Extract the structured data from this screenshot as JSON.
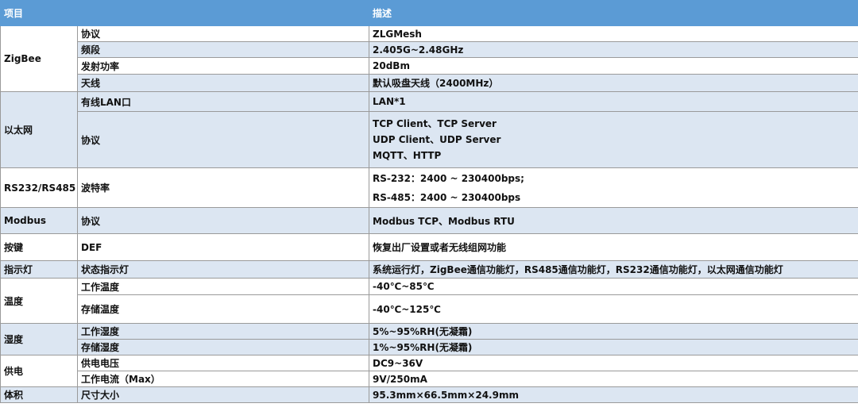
{
  "header": {
    "item": "项目",
    "description": "描述"
  },
  "rows": {
    "zigbee": {
      "category": "ZigBee",
      "protocol": {
        "label": "协议",
        "value": "ZLGMesh"
      },
      "band": {
        "label": "频段",
        "value": "2.405G~2.48GHz"
      },
      "power": {
        "label": "发射功率",
        "value": "20dBm"
      },
      "antenna": {
        "label": "天线",
        "value": "默认吸盘天线（2400MHz）"
      }
    },
    "ethernet": {
      "category": "以太网",
      "lan": {
        "label": "有线LAN口",
        "value": "LAN*1"
      },
      "protocol": {
        "label": "协议",
        "line1": "TCP Client、TCP Server",
        "line2": "UDP Client、UDP Server",
        "line3": "MQTT、HTTP"
      }
    },
    "serial": {
      "category": "RS232/RS485",
      "baud": {
        "label": "波特率",
        "line1": "RS-232：2400 ~ 230400bps;",
        "line2": "RS-485：2400 ~ 230400bps"
      }
    },
    "modbus": {
      "category": "Modbus",
      "label": "协议",
      "value": "Modbus TCP、Modbus RTU"
    },
    "key": {
      "category": "按键",
      "label": "DEF",
      "value": "恢复出厂设置或者无线组网功能"
    },
    "indicator": {
      "category": "指示灯",
      "label": "状态指示灯",
      "value": "系统运行灯，ZigBee通信功能灯，RS485通信功能灯，RS232通信功能灯，以太网通信功能灯"
    },
    "temperature": {
      "category": "温度",
      "working": {
        "label": "工作温度",
        "value": "-40℃~85℃"
      },
      "storage": {
        "label": "存储温度",
        "value": "-40℃~125℃"
      }
    },
    "humidity": {
      "category": "湿度",
      "working": {
        "label": "工作湿度",
        "value": "5%~95%RH(无凝霜)"
      },
      "storage": {
        "label": "存储湿度",
        "value": "1%~95%RH(无凝霜)"
      }
    },
    "power_supply": {
      "category": "供电",
      "voltage": {
        "label": "供电电压",
        "value": "DC9~36V"
      },
      "current": {
        "label": "工作电流（Max）",
        "value": "9V/250mA"
      }
    },
    "volume": {
      "category": "体积",
      "label": "尺寸大小",
      "value": "95.3mm×66.5mm×24.9mm"
    }
  }
}
